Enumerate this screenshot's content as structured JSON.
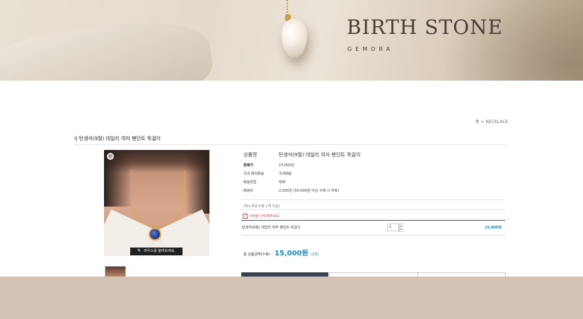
{
  "hero": {
    "title": "BIRTH STONE",
    "subtitle": "GEMORA"
  },
  "breadcrumb": {
    "home": "홈",
    "separator": ">",
    "category": "NECKLACE"
  },
  "product": {
    "heading": "탄생석(9월) 데일리 여자 펜던트 목걸이",
    "name_label": "상품명",
    "name": "탄생석(9월) 데일리 여자 펜던트 목걸이",
    "info": [
      {
        "label": "판매가",
        "value": "15,000원"
      },
      {
        "label": "국내·해외배송",
        "value": "국내배송"
      },
      {
        "label": "배송방법",
        "value": "택배"
      },
      {
        "label": "배송비",
        "value": "2,500원 (50,000원 이상 구매 시 무료)"
      }
    ],
    "min_order": "(최소주문수량 1개 이상)",
    "option_notice": "수량을 선택해주세요.",
    "zoom_hint": "마우스를 올려보세요.",
    "selected_option": {
      "name": "탄생석(9월) 데일리 여자 펜던트 목걸이",
      "quantity": "1",
      "price": "15,000원"
    },
    "total": {
      "label": "총 상품금액(수량) :",
      "amount": "15,000원",
      "count": "(1개)"
    }
  },
  "icons": {
    "zoom": "zoom-in-icon",
    "magnifier": "magnifier-icon",
    "notice": "checkbox-icon"
  },
  "colors": {
    "accent": "#1a8ac0",
    "notice": "#e05252",
    "buy_button": "#3c4151",
    "footer": "#d3c3b4"
  }
}
